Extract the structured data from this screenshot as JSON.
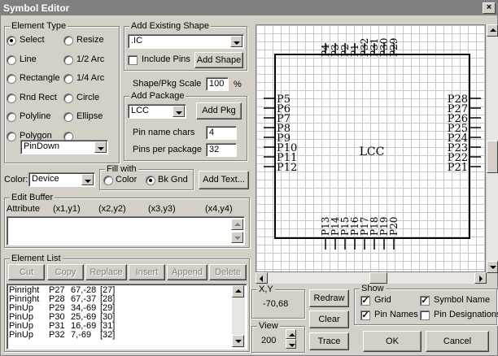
{
  "window": {
    "title": "Symbol Editor",
    "close_glyph": "×"
  },
  "element_type": {
    "label": "Element Type",
    "options": [
      {
        "label": "Select",
        "selected": true
      },
      {
        "label": "Resize",
        "selected": false
      },
      {
        "label": "Line",
        "selected": false
      },
      {
        "label": "1/2 Arc",
        "selected": false
      },
      {
        "label": "Rectangle",
        "selected": false
      },
      {
        "label": "1/4 Arc",
        "selected": false
      },
      {
        "label": "Rnd Rect",
        "selected": false
      },
      {
        "label": "Circle",
        "selected": false
      },
      {
        "label": "Polyline",
        "selected": false
      },
      {
        "label": "Ellipse",
        "selected": false
      },
      {
        "label": "Polygon",
        "selected": false
      },
      {
        "label": "",
        "selected": false
      }
    ],
    "pin_type_value": "PinDown"
  },
  "add_existing_shape": {
    "label": "Add Existing Shape",
    "shape_value": ".IC",
    "include_pins_label": "Include Pins",
    "include_pins_checked": false,
    "add_shape_button": "Add Shape"
  },
  "scale": {
    "label": "Shape/Pkg Scale",
    "value": "100",
    "unit": "%"
  },
  "add_package": {
    "label": "Add Package",
    "package_value": "LCC",
    "add_pkg_button": "Add Pkg",
    "pin_name_chars_label": "Pin name chars",
    "pin_name_chars_value": "4",
    "pins_per_package_label": "Pins per package",
    "pins_per_package_value": "32"
  },
  "color": {
    "label": "Color:",
    "value": "Device"
  },
  "fill_with": {
    "label": "Fill with",
    "options": [
      {
        "label": "Color",
        "selected": false
      },
      {
        "label": "Bk Gnd",
        "selected": true
      }
    ]
  },
  "add_text_button": "Add Text...",
  "edit_buffer": {
    "label": "Edit Buffer",
    "headers": [
      "Attribute",
      "(x1,y1)",
      "(x2,y2)",
      "(x3,y3)",
      "(x4,y4)"
    ],
    "value": ""
  },
  "element_list": {
    "label": "Element List",
    "buttons": [
      "Cut",
      "Copy",
      "Replace",
      "Insert",
      "Append",
      "Delete"
    ],
    "rows": [
      [
        "Pinright",
        "P27",
        "67,-28",
        "[27]"
      ],
      [
        "Pinright",
        "P28",
        "67,-37",
        "[28]"
      ],
      [
        "PinUp",
        "P29",
        "34,-69",
        "[29]"
      ],
      [
        "PinUp",
        "P30",
        "25,-69",
        "[30]"
      ],
      [
        "PinUp",
        "P31",
        "16,-69",
        "[31]"
      ],
      [
        "PinUp",
        "P32",
        "7,-69",
        "[32]"
      ]
    ]
  },
  "canvas": {
    "package_name": "LCC",
    "top_pins": [
      "P4",
      "P3",
      "P2",
      "P1",
      "P32",
      "P31",
      "P30",
      "P29"
    ],
    "bottom_pins": [
      "P13",
      "P14",
      "P15",
      "P16",
      "P17",
      "P18",
      "P19",
      "P20"
    ],
    "left_pins": [
      "P5",
      "P6",
      "P7",
      "P8",
      "P9",
      "P10",
      "P11",
      "P12"
    ],
    "right_pins": [
      "P28",
      "P27",
      "P26",
      "P25",
      "P24",
      "P23",
      "P22",
      "P21"
    ]
  },
  "xy": {
    "label": "X,Y",
    "value": "-70,68"
  },
  "view": {
    "label": "View",
    "value": "200"
  },
  "buttons": {
    "redraw": "Redraw",
    "clear": "Clear",
    "trace": "Trace",
    "ok": "OK",
    "cancel": "Cancel"
  },
  "show": {
    "label": "Show",
    "grid_label": "Grid",
    "grid_checked": true,
    "symbol_name_label": "Symbol Name",
    "symbol_name_checked": true,
    "pin_names_label": "Pin Names",
    "pin_names_checked": true,
    "pin_designations_label": "Pin Designations",
    "pin_designations_checked": false
  },
  "check_glyph": "✓"
}
